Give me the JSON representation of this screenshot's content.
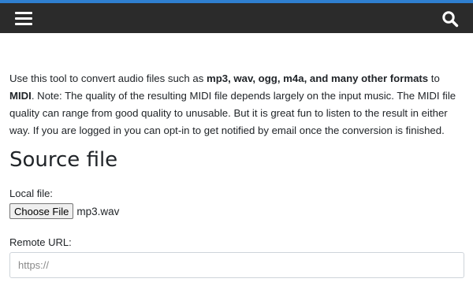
{
  "header": {
    "menu_icon": "hamburger-menu-icon",
    "search_icon": "search-icon",
    "bar_color": "#2b2b2b",
    "accent_color": "#2f7fd0"
  },
  "intro": {
    "part1": "Use this tool to convert audio files such as ",
    "formats": "mp3, wav, ogg, m4a, and many other formats",
    "part2": " to ",
    "target": "MIDI",
    "part3": ". Note: The quality of the resulting MIDI file depends largely on the input music. The MIDI file quality can range from good quality to unusable. But it is great fun to listen to the result in either way. If you are logged in you can opt-in to get notified by email once the conversion is finished."
  },
  "source": {
    "title": "Source file",
    "local_label": "Local file:",
    "choose_button": "Choose File",
    "selected_file": "mp3.wav",
    "remote_label": "Remote URL:",
    "url_placeholder": "https://"
  }
}
